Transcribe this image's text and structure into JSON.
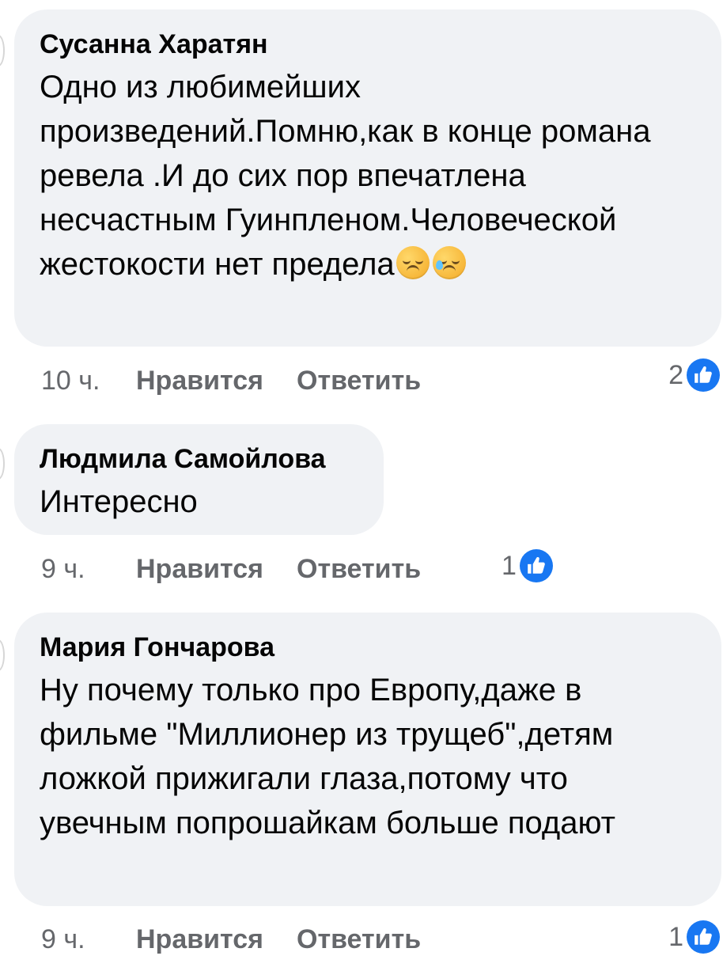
{
  "comments": [
    {
      "author": "Сусанна Харатян",
      "text": "Одно из любимейших произведений.Помню,как в конце романа ревела .И до сих пор впечатлена несчастным Гуинпленом.Человеческой жестокости нет предела",
      "emoji_1": "pensive-face-icon",
      "emoji_2": "sad-but-relieved-face-icon",
      "time": "10 ч.",
      "like_label": "Нравится",
      "reply_label": "Ответить",
      "reaction_count": "2"
    },
    {
      "author": "Людмила Самойлова",
      "text": "Интересно",
      "time": "9 ч.",
      "like_label": "Нравится",
      "reply_label": "Ответить",
      "reaction_count": "1"
    },
    {
      "author": "Мария Гончарова",
      "text": "Ну почему только про Европу,даже в фильме \"Миллионер из трущеб\",детям ложкой прижигали глаза,потому что увечным попрошайкам больше подают",
      "time": "9 ч.",
      "like_label": "Нравится",
      "reply_label": "Ответить",
      "reaction_count": "1"
    }
  ],
  "theme": {
    "bubble_background": "#f0f2f5",
    "text_color": "#050505",
    "meta_color": "#65676b",
    "like_blue": "#1877f2"
  }
}
